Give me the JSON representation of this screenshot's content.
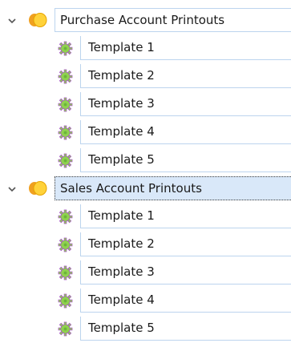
{
  "tree": {
    "groups": [
      {
        "label": "Purchase Account Printouts",
        "selected": false,
        "expanded": true,
        "icon": "folder-icon",
        "children": [
          {
            "label": "Template 1",
            "icon": "gear-icon"
          },
          {
            "label": "Template 2",
            "icon": "gear-icon"
          },
          {
            "label": "Template 3",
            "icon": "gear-icon"
          },
          {
            "label": "Template 4",
            "icon": "gear-icon"
          },
          {
            "label": "Template 5",
            "icon": "gear-icon"
          }
        ]
      },
      {
        "label": "Sales Account Printouts",
        "selected": true,
        "expanded": true,
        "icon": "folder-icon",
        "children": [
          {
            "label": "Template 1",
            "icon": "gear-icon"
          },
          {
            "label": "Template 2",
            "icon": "gear-icon"
          },
          {
            "label": "Template 3",
            "icon": "gear-icon"
          },
          {
            "label": "Template 4",
            "icon": "gear-icon"
          },
          {
            "label": "Template 5",
            "icon": "gear-icon"
          }
        ]
      }
    ]
  },
  "colors": {
    "selection_bg": "#d9e8f9",
    "row_border": "#bcd4ee",
    "gear": "#8fd14f",
    "gear_outline": "#a64fc9",
    "folder_orange": "#f0a020",
    "folder_yellow": "#ffd23a"
  }
}
